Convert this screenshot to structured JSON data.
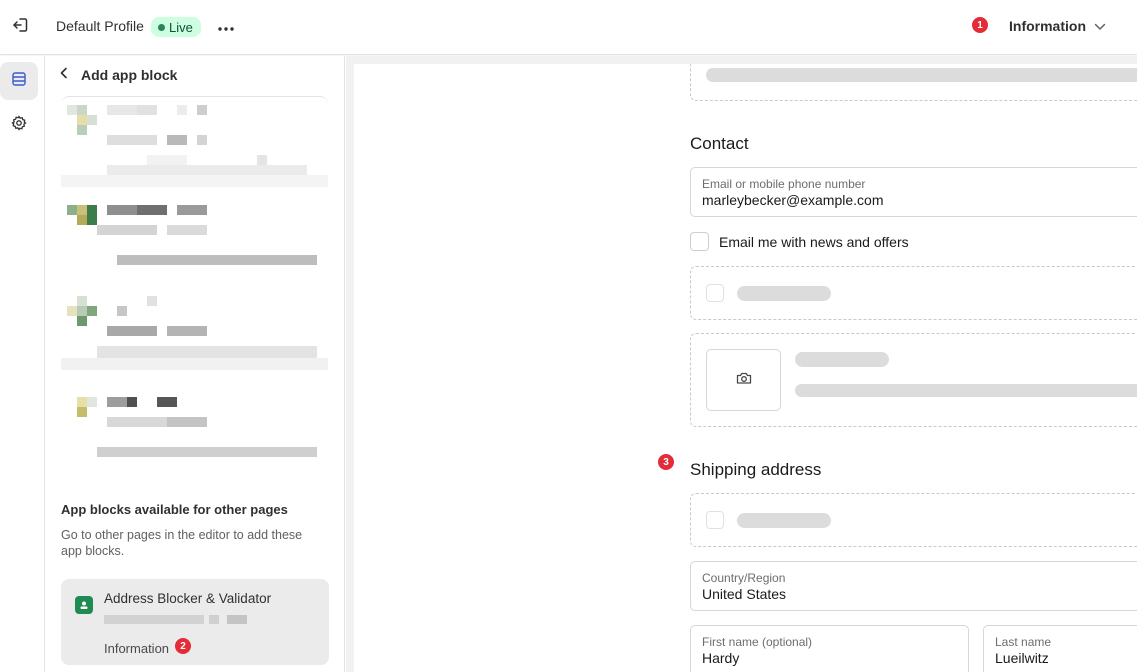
{
  "topbar": {
    "profile_name": "Default Profile",
    "live_label": "Live",
    "notification_count": "1",
    "page_selector": "Information"
  },
  "sidebar": {
    "title": "Add app block",
    "other_pages_title": "App blocks available for other pages",
    "other_pages_desc": "Go to other pages in the editor to add these app blocks.",
    "app_card": {
      "name": "Address Blocker & Validator",
      "page": "Information",
      "badge": "2"
    }
  },
  "preview": {
    "contact_title": "Contact",
    "email_field": {
      "label": "Email or mobile phone number",
      "value": "marleybecker@example.com"
    },
    "news_checkbox_label": "Email me with news and offers",
    "shipping_badge": "3",
    "shipping_title": "Shipping address",
    "country_field": {
      "label": "Country/Region",
      "value": "United States"
    },
    "first_name_field": {
      "label": "First name (optional)",
      "value": "Hardy"
    },
    "last_name_field": {
      "label": "Last name",
      "value": "Lueilwitz"
    }
  },
  "icons": {
    "exit": "exit-icon",
    "more": "more-horizontal-icon",
    "chevron_down": "chevron-down-icon",
    "sections": "sections-icon",
    "settings": "gear-icon",
    "back": "chevron-left-icon",
    "app": "app-icon",
    "camera": "camera-icon"
  },
  "colors": {
    "live_badge_bg": "#cdfee1",
    "live_dot": "#29845a",
    "notification_red": "#e22c38",
    "app_icon_green": "#1f8a52"
  }
}
